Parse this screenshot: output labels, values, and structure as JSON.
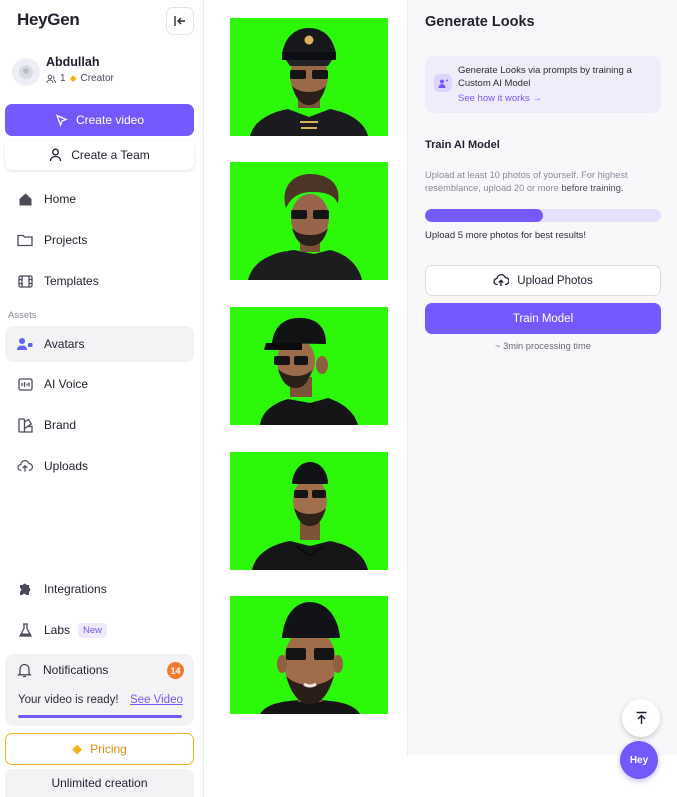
{
  "app": {
    "logo": "HeyGen"
  },
  "user": {
    "name": "Abdullah",
    "members": "1",
    "plan": "Creator"
  },
  "actions": {
    "create_video": "Create video",
    "create_team": "Create a Team"
  },
  "nav": {
    "main": [
      {
        "label": "Home",
        "icon": "home-icon"
      },
      {
        "label": "Projects",
        "icon": "folder-icon"
      },
      {
        "label": "Templates",
        "icon": "film-icon"
      }
    ],
    "assets_label": "Assets",
    "assets": [
      {
        "label": "Avatars",
        "icon": "avatar-icon",
        "active": true
      },
      {
        "label": "AI Voice",
        "icon": "voice-icon"
      },
      {
        "label": "Brand",
        "icon": "brand-icon"
      },
      {
        "label": "Uploads",
        "icon": "upload-cloud-icon"
      }
    ],
    "bottom": [
      {
        "label": "Integrations",
        "icon": "puzzle-icon"
      },
      {
        "label": "Labs",
        "icon": "flask-icon",
        "badge": "New"
      }
    ]
  },
  "notifications": {
    "label": "Notifications",
    "count": "14",
    "message": "Your video is ready!",
    "link": "See Video"
  },
  "pricing": {
    "label": "Pricing"
  },
  "plan_banner": {
    "label": "Unlimited creation"
  },
  "photos": [
    {
      "alt": "photo-1",
      "background": "#2df80a"
    },
    {
      "alt": "photo-2",
      "background": "#2df80a"
    },
    {
      "alt": "photo-3",
      "background": "#2df80a"
    },
    {
      "alt": "photo-4",
      "background": "#2df80a"
    },
    {
      "alt": "photo-5",
      "background": "#2df80a"
    }
  ],
  "panel": {
    "title": "Generate Looks",
    "info_text": "Generate Looks via prompts by training a Custom AI Model",
    "info_link": "See how it works →",
    "train_title": "Train AI Model",
    "train_desc_pre": "Upload at least 10 photos of yourself. For highest resemblance, upload 20 or more ",
    "train_desc_emph": "before training.",
    "progress": 0.5,
    "progress_note": "Upload 5 more photos for best results!",
    "upload_label": "Upload Photos",
    "train_label": "Train Model",
    "processing": "~ 3min processing time"
  },
  "fab": {
    "label": "Hey"
  },
  "colors": {
    "accent": "#7559ff",
    "green_screen": "#2df80a",
    "badge": "#f27b2f",
    "gold": "#f6b21a"
  }
}
